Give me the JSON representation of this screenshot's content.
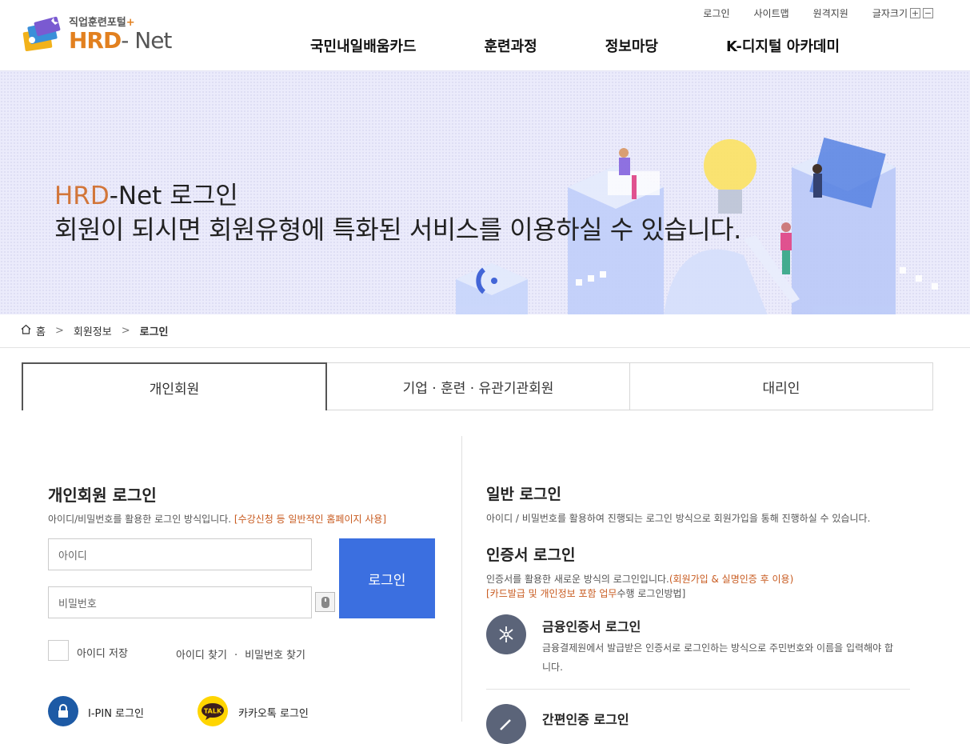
{
  "util": {
    "login": "로그인",
    "sitemap": "사이트맵",
    "remote": "원격지원",
    "fontsize": "글자크기",
    "plus": "+",
    "minus": "−"
  },
  "logo": {
    "sub": "직업훈련포털",
    "sub_plus": "+",
    "main_a": "HRD",
    "main_b": "- Net"
  },
  "gnb": [
    "국민내일배움카드",
    "훈련과정",
    "정보마당",
    "K-디지털 아카데미"
  ],
  "hero": {
    "title_a": "HRD",
    "title_b": "-Net 로그인",
    "subtitle": "회원이 되시면 회원유형에 특화된 서비스를 이용하실 수 있습니다."
  },
  "breadcrumb": {
    "home": "홈",
    "sep": ">",
    "level1": "회원정보",
    "current": "로그인"
  },
  "tabs": [
    "개인회원",
    "기업 · 훈련 · 유관기관회원",
    "대리인"
  ],
  "login": {
    "title": "개인회원 로그인",
    "desc": "아이디/비밀번호를 활용한 로그인 방식입니다. ",
    "desc_hl": "[수강신청 등 일반적인 홈페이지 사용]",
    "id_placeholder": "아이디",
    "pw_placeholder": "비밀번호",
    "button": "로그인",
    "save_id": "아이디 저장",
    "find_id": "아이디 찾기",
    "find_dot": "·",
    "find_pw": "비밀번호 찾기",
    "ipin": "I-PIN 로그인",
    "kakao": "카카오톡 로그인",
    "kakao_badge": "TALK"
  },
  "general": {
    "title": "일반 로그인",
    "desc": "아이디 / 비밀번호를 활용하여 진행되는 로그인 방식으로 회원가입을 통해 진행하실 수 있습니다."
  },
  "cert": {
    "title": "인증서 로그인",
    "desc": "인증서를 활용한 새로운 방식의 로그인입니다.",
    "desc_hl": "(회원가입 & 실명인증 후 이용)",
    "desc2_hl": "[카드발급 및 개인정보 포함 업무",
    "desc2": "수행 로그인방법]",
    "fin_title": "금융인증서 로그인",
    "fin_desc": "금융결제원에서 발급받은 인증서로 로그인하는 방식으로 주민번호와 이름을 입력해야 합니다.",
    "simple_title": "간편인증 로그인"
  },
  "colors": {
    "brand": "#e2801f",
    "login_button": "#3b6fe0",
    "hero_bg": "#ebebfb",
    "highlight": "#c85a1f"
  }
}
